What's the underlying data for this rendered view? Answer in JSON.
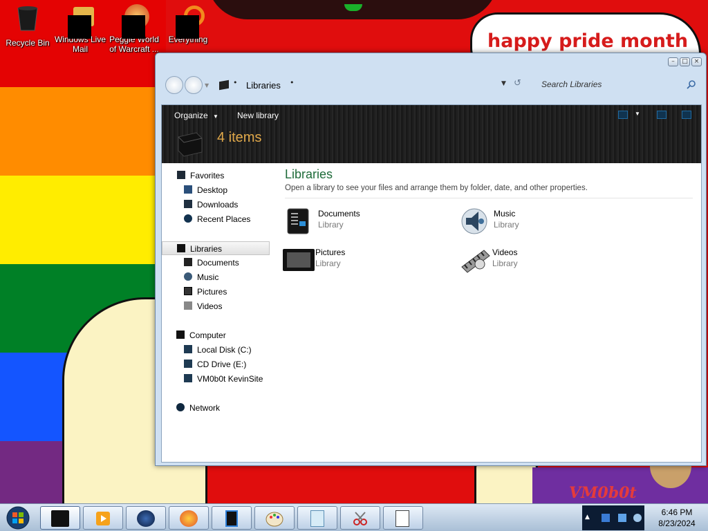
{
  "desktop": {
    "banner_text": "happy pride month",
    "watermark_text": "VM0b0t",
    "icons": [
      {
        "label": "Recycle Bin"
      },
      {
        "label": "Windows Live Mail"
      },
      {
        "label": "Peggle World of Warcraft ..."
      },
      {
        "label": "Everything"
      }
    ]
  },
  "explorer": {
    "breadcrumb": "Libraries",
    "search_placeholder": "Search Libraries",
    "toolbar": {
      "organize_label": "Organize",
      "new_library_label": "New library"
    },
    "details": {
      "count_text": "4 items"
    },
    "sidebar": {
      "favorites": {
        "label": "Favorites",
        "items": [
          "Desktop",
          "Downloads",
          "Recent Places"
        ]
      },
      "libraries": {
        "label": "Libraries",
        "items": [
          "Documents",
          "Music",
          "Pictures",
          "Videos"
        ]
      },
      "computer": {
        "label": "Computer",
        "items": [
          "Local Disk (C:)",
          "CD Drive (E:)",
          "VM0b0t KevinSite"
        ]
      },
      "network": {
        "label": "Network"
      }
    },
    "content": {
      "title": "Libraries",
      "subtitle": "Open a library to see your files and arrange them by folder, date, and other properties.",
      "libraries": [
        {
          "name": "Documents",
          "type": "Library"
        },
        {
          "name": "Music",
          "type": "Library"
        },
        {
          "name": "Pictures",
          "type": "Library"
        },
        {
          "name": "Videos",
          "type": "Library"
        }
      ]
    }
  },
  "taskbar": {
    "pinned": [
      "explorer",
      "media-player",
      "globe",
      "firefox",
      "device",
      "paint",
      "notepad",
      "snipping-tool",
      "solitaire"
    ],
    "clock_time": "6:46 PM",
    "clock_date": "8/23/2024"
  },
  "colors": {
    "accent_green": "#1e6b39",
    "items_count_orange": "#e0a84a",
    "banner_red": "#d61b1b"
  }
}
